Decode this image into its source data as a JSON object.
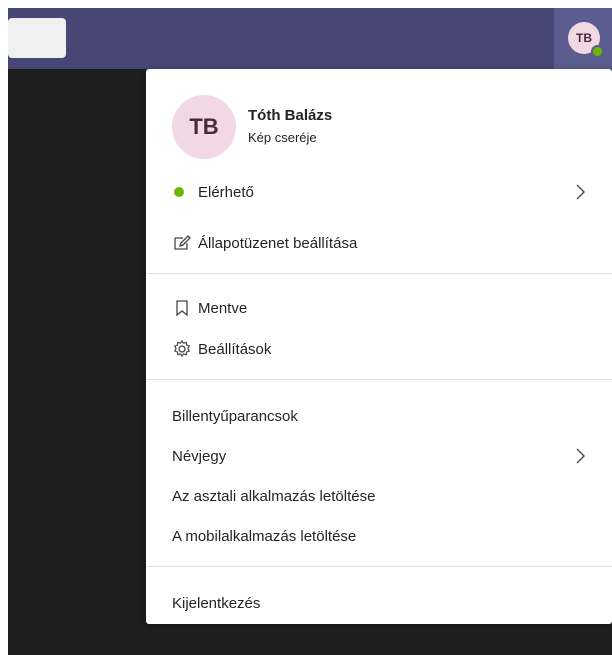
{
  "topbar": {
    "user_initials": "TB"
  },
  "profile": {
    "initials": "TB",
    "name": "Tóth Balázs",
    "change_picture": "Kép cseréje"
  },
  "status": {
    "label": "Elérhető",
    "color": "#6bb700"
  },
  "menu": {
    "set_status_message": "Állapotüzenet beállítása",
    "saved": "Mentve",
    "settings": "Beállítások",
    "keyboard_shortcuts": "Billentyűparancsok",
    "about": "Névjegy",
    "download_desktop": "Az asztali alkalmazás letöltése",
    "download_mobile": "A mobilalkalmazás letöltése",
    "sign_out": "Kijelentkezés"
  },
  "colors": {
    "topbar": "#464775",
    "background": "#1f1f1f",
    "avatar_bg": "#f2d7e5"
  }
}
